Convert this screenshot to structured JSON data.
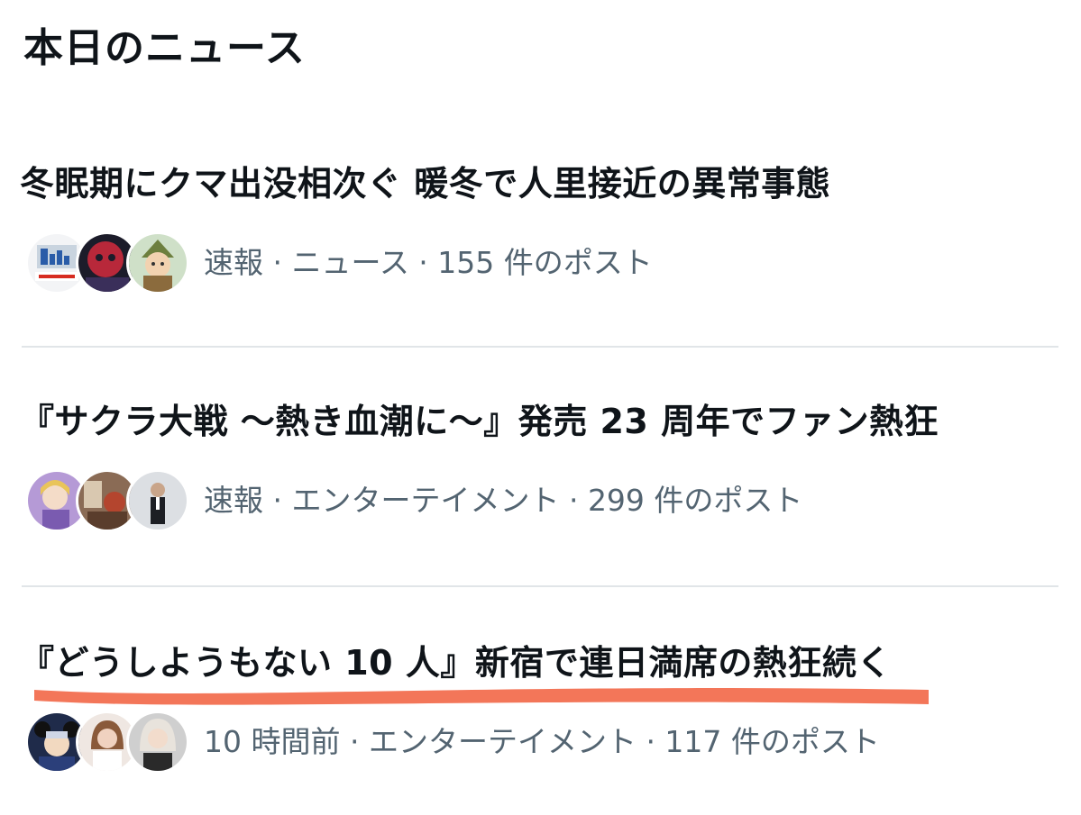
{
  "section": {
    "title": "本日のニュース"
  },
  "news": [
    {
      "headline": "冬眠期にクマ出没相次ぐ 暖冬で人里接近の異常事態",
      "meta": "速報 · ニュース · 155 件のポスト",
      "avatars": [
        "yahoo-news-logo-avatar",
        "red-character-avatar",
        "backpack-character-avatar"
      ]
    },
    {
      "headline": "『サクラ大戦 〜熱き血潮に〜』発売 23 周年でファン熱狂",
      "meta": "速報 · エンターテイメント · 299 件のポスト",
      "avatars": [
        "anime-character-avatar",
        "room-photo-avatar",
        "suited-man-avatar"
      ]
    },
    {
      "headline": "『どうしようもない 10 人』新宿で連日満席の熱狂続く",
      "meta": "10 時間前 · エンターテイメント · 117 件のポスト",
      "avatars": [
        "mouse-character-avatar",
        "woman-photo-avatar",
        "light-hair-photo-avatar"
      ]
    }
  ],
  "colors": {
    "text_primary": "#0f1419",
    "text_secondary": "#536471",
    "divider": "#e1e5e8",
    "highlight": "#f26a4b"
  }
}
